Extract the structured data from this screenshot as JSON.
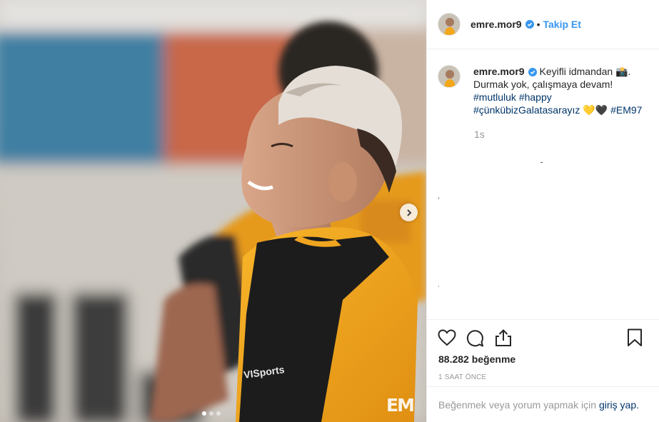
{
  "post": {
    "username": "emre.mor9",
    "separator": "•",
    "follow_label": "Takip Et",
    "caption": {
      "line1": "Keyifli idmandan",
      "camera_emoji": "📸",
      "line1_end": ".",
      "line2": "Durmak yok, çalışmaya devam!",
      "tags": [
        "#mutluluk",
        "#happy",
        "#çünkübizGalatasarayız",
        "#EM97"
      ],
      "heart_emojis": "💛🖤"
    },
    "time_ago": "1s",
    "likes": "88.282 beğenme",
    "posted": "1 SAAT ÖNCE",
    "login_prompt": "Beğenmek veya yorum yapmak için",
    "login_link": "giriş yap."
  },
  "photo": {
    "watermark": "EM",
    "shirt_text": "VISports",
    "carousel": {
      "count": 3,
      "active": 1
    }
  },
  "icons": [
    "verified-badge-icon",
    "chevron-right-icon",
    "heart-icon",
    "comment-icon",
    "share-icon",
    "bookmark-icon"
  ],
  "colors": {
    "accent_blue": "#3897f0",
    "hashtag_blue": "#003569",
    "jersey_yellow": "#f3a719",
    "muted_text": "#999999"
  }
}
